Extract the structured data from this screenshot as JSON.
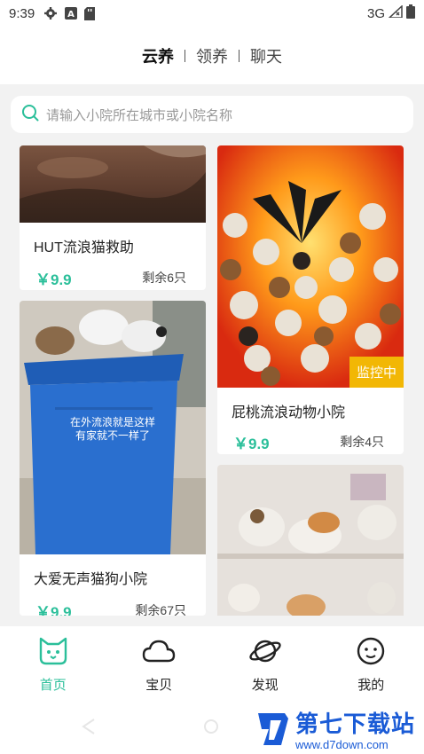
{
  "status_bar": {
    "time": "9:39",
    "network": "3G"
  },
  "top_nav": {
    "tabs": [
      {
        "label": "云养"
      },
      {
        "label": "领养"
      },
      {
        "label": "聊天"
      }
    ],
    "active": 0
  },
  "search": {
    "placeholder": "请输入小院所在城市或小院名称"
  },
  "cards": [
    {
      "title": "HUT流浪猫救助",
      "price": "￥9.9",
      "remaining": "剩余6只"
    },
    {
      "title": "大爱无声猫狗小院",
      "price": "￥9.9",
      "remaining": "剩余67只",
      "image_caption": "在外流浪就是这样\n有家就不一样了"
    },
    {
      "title": "屁桃流浪动物小院",
      "price": "￥9.9",
      "remaining": "剩余4只",
      "badge": "监控中"
    },
    {
      "title": "",
      "price": "",
      "remaining": ""
    }
  ],
  "bottom_nav": {
    "items": [
      {
        "label": "首页",
        "icon": "cat-face-icon"
      },
      {
        "label": "宝贝",
        "icon": "cloud-icon"
      },
      {
        "label": "发现",
        "icon": "planet-icon"
      },
      {
        "label": "我的",
        "icon": "smiley-icon"
      }
    ],
    "active": 0
  },
  "watermark": {
    "title": "第七下载站",
    "url": "www.d7down.com"
  },
  "colors": {
    "accent": "#2bbf9a",
    "badge": "#f2b705",
    "watermark": "#1a5bd6"
  }
}
